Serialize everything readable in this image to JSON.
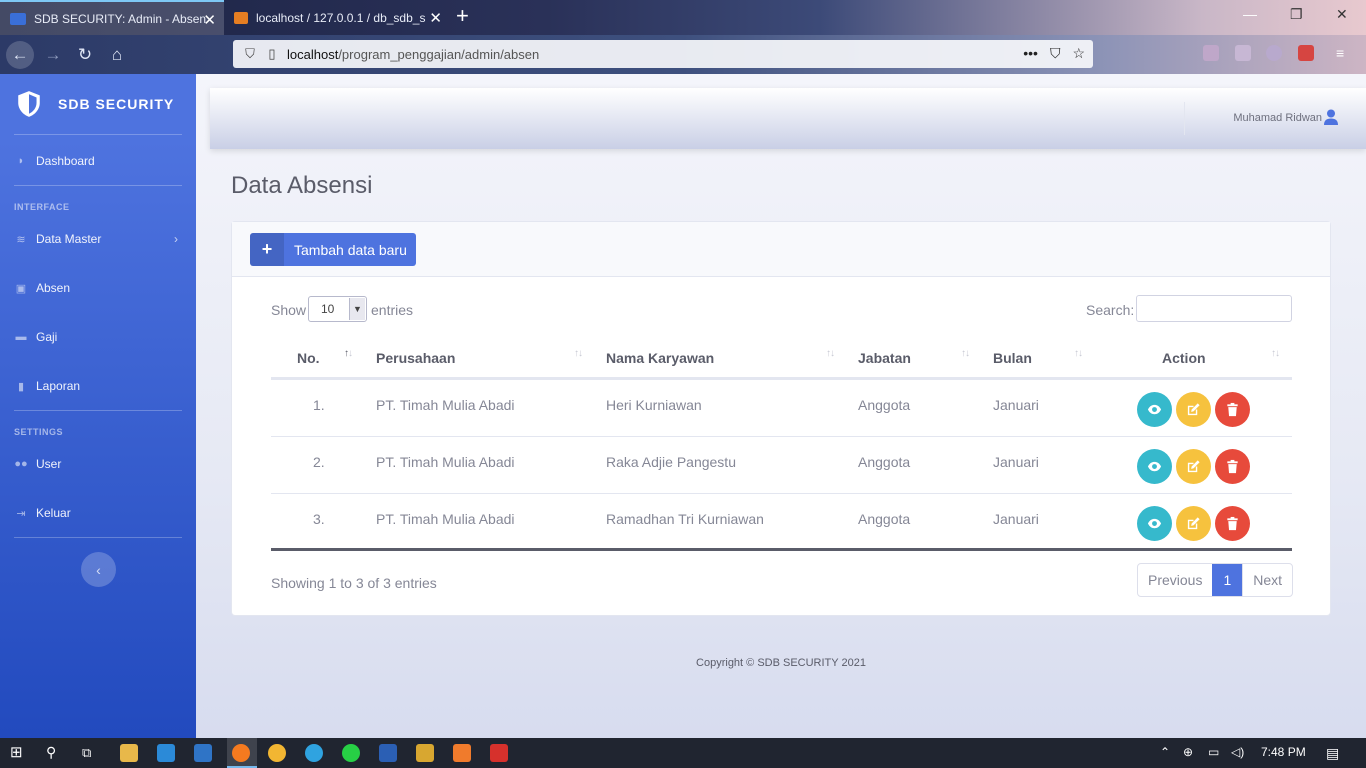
{
  "browser": {
    "tabs": [
      {
        "title": "SDB SECURITY: Admin - Absen",
        "active": true
      },
      {
        "title": "localhost / 127.0.0.1 / db_sdb_s",
        "active": false
      }
    ],
    "url_host": "localhost",
    "url_path": "/program_penggajian/admin/absen"
  },
  "sidebar": {
    "brand": "SDB SECURITY",
    "dashboard": "Dashboard",
    "heading_interface": "INTERFACE",
    "data_master": "Data Master",
    "absen": "Absen",
    "gaji": "Gaji",
    "laporan": "Laporan",
    "heading_settings": "SETTINGS",
    "user": "User",
    "keluar": "Keluar"
  },
  "topbar": {
    "user_name": "Muhamad Ridwan"
  },
  "page": {
    "title": "Data Absensi",
    "add_button": "Tambah data baru",
    "show_label": "Show",
    "entries_label": "entries",
    "page_length": "10",
    "search_label": "Search:",
    "columns": [
      "No.",
      "Perusahaan",
      "Nama Karyawan",
      "Jabatan",
      "Bulan",
      "Action"
    ],
    "rows": [
      {
        "no": "1.",
        "perusahaan": "PT. Timah Mulia Abadi",
        "nama": "Heri Kurniawan",
        "jabatan": "Anggota",
        "bulan": "Januari"
      },
      {
        "no": "2.",
        "perusahaan": "PT. Timah Mulia Abadi",
        "nama": "Raka Adjie Pangestu",
        "jabatan": "Anggota",
        "bulan": "Januari"
      },
      {
        "no": "3.",
        "perusahaan": "PT. Timah Mulia Abadi",
        "nama": "Ramadhan Tri Kurniawan",
        "jabatan": "Anggota",
        "bulan": "Januari"
      }
    ],
    "info": "Showing 1 to 3 of 3 entries",
    "prev": "Previous",
    "current_page": "1",
    "next": "Next"
  },
  "footer": "Copyright © SDB SECURITY 2021",
  "taskbar": {
    "time": "7:48 PM"
  },
  "colors": {
    "primary": "#4e73df",
    "info": "#36b9cc",
    "warning": "#f6c23e",
    "danger": "#e74a3b"
  }
}
